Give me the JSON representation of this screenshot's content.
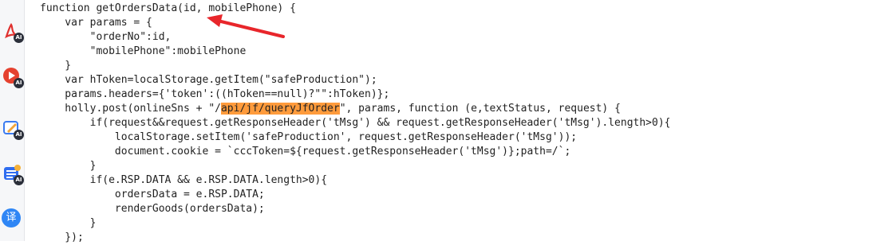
{
  "sidebar": {
    "items": [
      {
        "name": "pdf-ai",
        "badge": "AI"
      },
      {
        "name": "video-ai",
        "badge": "AI"
      },
      {
        "name": "write-ai",
        "badge": "AI"
      },
      {
        "name": "list-ai",
        "badge": "AI"
      },
      {
        "name": "translate",
        "glyph": "译"
      }
    ]
  },
  "code": {
    "lines": [
      "function getOrdersData(id, mobilePhone) {",
      "    var params = {",
      "        \"orderNo\":id,",
      "        \"mobilePhone\":mobilePhone",
      "    }",
      "    var hToken=localStorage.getItem(\"safeProduction\");",
      "    params.headers={'token':((hToken==null)?\"\":hToken)};",
      "    holly.post(onlineSns + \"/",
      "        if(request&&request.getResponseHeader('tMsg') && request.getResponseHeader('tMsg').length>0){",
      "            localStorage.setItem('safeProduction', request.getResponseHeader('tMsg'));",
      "            document.cookie = `cccToken=${request.getResponseHeader('tMsg')};path=/`;",
      "        }",
      "        if(e.RSP.DATA && e.RSP.DATA.length>0){",
      "            ordersData = e.RSP.DATA;",
      "            renderGoods(ordersData);",
      "        }",
      "    });"
    ],
    "highlight": "api/jf/queryJfOrder",
    "line8_suffix": "\", params, function (e,textStatus, request) {"
  },
  "colors": {
    "highlight": "#ff9b3c",
    "arrow": "#e8262b"
  }
}
